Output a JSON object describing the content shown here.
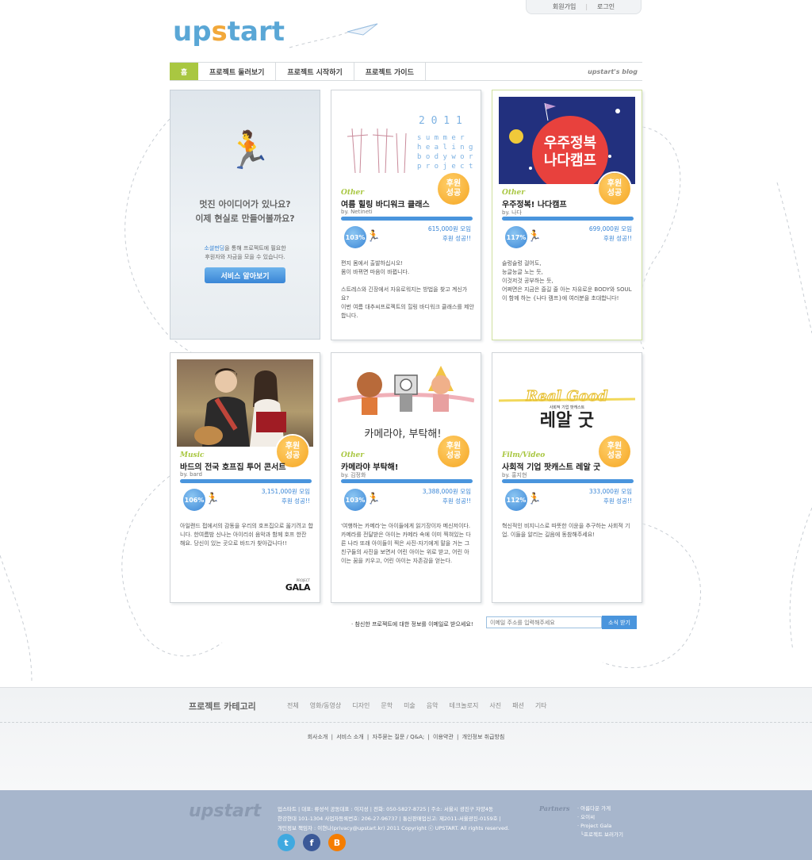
{
  "header": {
    "logo_pre": "up",
    "logo_s": "s",
    "logo_post": "tart",
    "util": {
      "join": "회원가입",
      "login": "로그인"
    }
  },
  "nav": {
    "home": "홈",
    "items": [
      "프로젝트 둘러보기",
      "프로젝트 시작하기",
      "프로젝트 가이드"
    ],
    "blog": "upstart's blog"
  },
  "promo": {
    "line1": "멋진 아이디어가 있나요?",
    "line2": "이제 현실로 만들어볼까요?",
    "text_link": "소셜펀딩",
    "text_rest1": "을 통해 프로젝트에 필요한",
    "text_rest2": "후원자와 자금을 모을 수 있습니다.",
    "button": "서비스 알아보기"
  },
  "cards": [
    {
      "category": "Other",
      "title": "여름 힐링 바디워크 클래스",
      "by_label": "by.",
      "by": "Netineti",
      "percent": "103%",
      "amount": "615,000원 모임",
      "status": "후원 성공!!",
      "badge1": "후원",
      "badge2": "성공",
      "thumb_text": "2011 summer healing bodywork project",
      "desc": "편지 몸에서 출발하십시오!\n몸이 바뀌면 마음이 바뀝니다.\n\n스트레스와 긴장에서 자유로워지는 방법을 찾고 계신가요?\n이번 여름 대추씨프로젝트의 힐링 바디워크 클래스를 제안합니다."
    },
    {
      "category": "Other",
      "title": "우주정복! 나다캠프",
      "by_label": "by.",
      "by": "나다",
      "percent": "117%",
      "amount": "699,000원 모임",
      "status": "후원 성공!!",
      "badge1": "후원",
      "badge2": "성공",
      "thumb_text1": "우주정복",
      "thumb_text2": "나다캠프",
      "desc": "슬렁슬렁 걸어도,\n능글능글 노는 듯,\n이것저것 공부하는 듯,\n어쩌면은 지금은 즐길 줄 아는 자유로운 BODY와 SOUL이 함께 하는 {나다 캠프}에 여러분을 초대합니다!"
    },
    {
      "category": "Music",
      "title": "바드의 전국 호프집 투어 콘서트",
      "by_label": "by.",
      "by": "bard",
      "percent": "106%",
      "amount": "3,151,000원 모임",
      "status": "후원 성공!!",
      "badge1": "후원",
      "badge2": "성공",
      "corner_small": "PROJECT",
      "corner_logo": "GALA",
      "desc": "아일랜드 펍에서의 감동을 우리의 호프집으로 옮기려고 합니다. 한여름밤 신나는 아이리쉬 음악과 함께 호프 한잔 해요. 당신이 있는 곳으로 바드가 찾아갑니다!!"
    },
    {
      "category": "Other",
      "title": "카메라야 부탁해!",
      "by_label": "by.",
      "by": "김정화",
      "percent": "103%",
      "amount": "3,388,000원 모임",
      "status": "후원 성공!!",
      "badge1": "후원",
      "badge2": "성공",
      "thumb_text": "카메라야, 부탁해!",
      "desc": "'여행하는 카메라'는 아이들에게 읽기장이자 메신저이다. 카메라를 전달받은 아이는 카메라 속에 이미 찍혀있는 다른 나라 또래 아이들이 찍은 사진-자기에게 말을 거는 그 친구들의 사진을 보면서 어린 아이는 위로 받고, 어린 아이는 꿈을 키우고, 어린 아이는 자존감을 얻는다."
    },
    {
      "category": "Film/Video",
      "title": "사회적 기업 팟캐스트 레알 굿",
      "by_label": "by.",
      "by": "홍지현",
      "percent": "112%",
      "amount": "333,000원 모임",
      "status": "후원 성공!!",
      "badge1": "후원",
      "badge2": "성공",
      "thumb_script": "Real Good",
      "thumb_small": "사회적 기업 팟캐스트",
      "thumb_main": "레알 굿",
      "desc": "혁신적인 비지니스로 따뜻한 이윤을 추구하는 사회적 기업. 이들을 알리는 길음에 동참해주세요!"
    }
  ],
  "newsletter": {
    "label": "· 참신한 프로젝트에 대한 정보를 이메일로 받으세요!",
    "placeholder": "이메일 주소를 입력해주세요",
    "button": "소식 받기"
  },
  "footer": {
    "cat_title": "프로젝트 카테고리",
    "categories": [
      "전체",
      "영화/동영상",
      "디자인",
      "문학",
      "미술",
      "음악",
      "테크놀로지",
      "사진",
      "패션",
      "기타"
    ],
    "links": [
      "회사소개",
      "서비스 소개",
      "자주묻는 질문 / Q&A;",
      "이용약관",
      "개인정보 취급방침"
    ],
    "logo": "upstart",
    "info1": "업스타트 | 대표: 류성석  공동대표 : 이지성 | 전화: 050-5827-8725 | 주소: 서울시 광진구 자양4동",
    "info2": "한강현대 101-1304 사업자등록번호: 206-27-96737 | 통신판매업신고: 제2011-서울광진-0159호 |",
    "info3": "개인정보 책임자 : 이현나(privacy@upstart.kr) 2011 Copyright ⓒ UPSTART. All rights reserved.",
    "partners_title": "Partners",
    "partners": [
      "· 아름다운 가게",
      "· 오이씨",
      "· Project Gala",
      "  └프로젝트 보러가기"
    ],
    "social": [
      "t",
      "f",
      "B"
    ]
  }
}
